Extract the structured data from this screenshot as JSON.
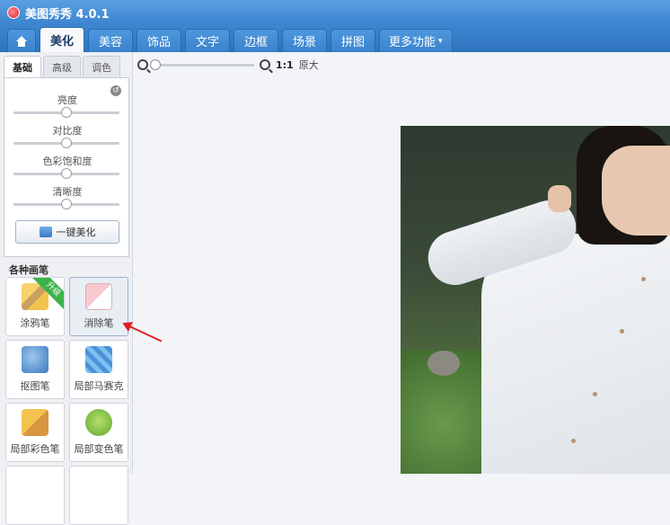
{
  "window": {
    "title": "美图秀秀 4.0.1"
  },
  "nav": {
    "tabs": [
      {
        "label": "美化"
      },
      {
        "label": "美容"
      },
      {
        "label": "饰品"
      },
      {
        "label": "文字"
      },
      {
        "label": "边框"
      },
      {
        "label": "场景"
      },
      {
        "label": "拼图"
      },
      {
        "label": "更多功能"
      }
    ],
    "more_caret": "▾"
  },
  "panel": {
    "subtabs": [
      {
        "label": "基础"
      },
      {
        "label": "高级"
      },
      {
        "label": "调色"
      }
    ],
    "reset_glyph": "↺",
    "sliders": [
      {
        "label": "亮度",
        "value": 0.5
      },
      {
        "label": "对比度",
        "value": 0.5
      },
      {
        "label": "色彩饱和度",
        "value": 0.5
      },
      {
        "label": "清晰度",
        "value": 0.5
      }
    ],
    "auto_button": "一键美化",
    "section_title": "各种画笔",
    "tools": [
      {
        "label": "涂鸦笔",
        "badge": "升级"
      },
      {
        "label": "消除笔"
      },
      {
        "label": "抠图笔"
      },
      {
        "label": "局部马赛克"
      },
      {
        "label": "局部彩色笔"
      },
      {
        "label": "局部变色笔"
      }
    ]
  },
  "zoom": {
    "ratio": "1:1",
    "original_label": "原大",
    "value": 0.0
  },
  "colors": {
    "nav_bg": "#3d86d0",
    "badge": "#3db24a",
    "arrow": "#e02020"
  }
}
